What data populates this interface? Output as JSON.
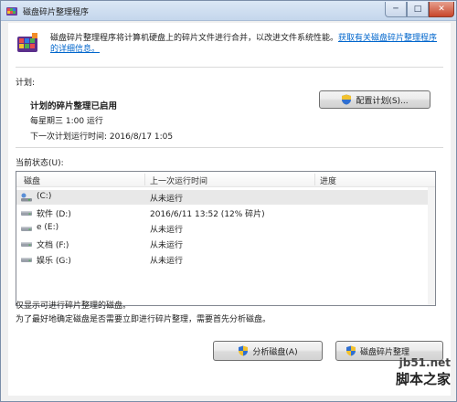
{
  "window": {
    "title": "磁盘碎片整理程序",
    "minimize_glyph": "─",
    "maximize_glyph": "□",
    "close_glyph": "✕"
  },
  "intro": {
    "text": "磁盘碎片整理程序将计算机硬盘上的碎片文件进行合并，以改进文件系统性能。",
    "link": "获取有关磁盘碎片整理程序的详细信息。"
  },
  "schedule": {
    "label": "计划:",
    "status": "计划的碎片整理已启用",
    "frequency": "每星期三  1:00 运行",
    "next_run": "下一次计划运行时间: 2016/8/17 1:05",
    "configure_button": "配置计划(S)..."
  },
  "current_status": {
    "label": "当前状态(U):",
    "columns": [
      "磁盘",
      "上一次运行时间",
      "进度"
    ],
    "disks": [
      {
        "name": "(C:)",
        "last_run": "从未运行",
        "progress": "",
        "icon": "system-drive-icon"
      },
      {
        "name": "软件 (D:)",
        "last_run": "2016/6/11 13:52 (12% 碎片)",
        "progress": "",
        "icon": "drive-icon"
      },
      {
        "name": "e (E:)",
        "last_run": "从未运行",
        "progress": "",
        "icon": "drive-icon"
      },
      {
        "name": "文档 (F:)",
        "last_run": "从未运行",
        "progress": "",
        "icon": "drive-icon"
      },
      {
        "name": "娱乐 (G:)",
        "last_run": "从未运行",
        "progress": "",
        "icon": "drive-icon"
      }
    ]
  },
  "notes": {
    "line1": "仅显示可进行碎片整理的磁盘。",
    "line2": "为了最好地确定磁盘是否需要立即进行碎片整理，需要首先分析磁盘。"
  },
  "actions": {
    "analyze_button": "分析磁盘(A)",
    "defrag_button": "磁盘碎片整理"
  },
  "watermark": {
    "url": "jb51.net",
    "site": "脚本之家"
  },
  "colors": {
    "link": "#0066cc",
    "title_bar": "#c4d6ec",
    "selection": "#e8e8e8"
  }
}
